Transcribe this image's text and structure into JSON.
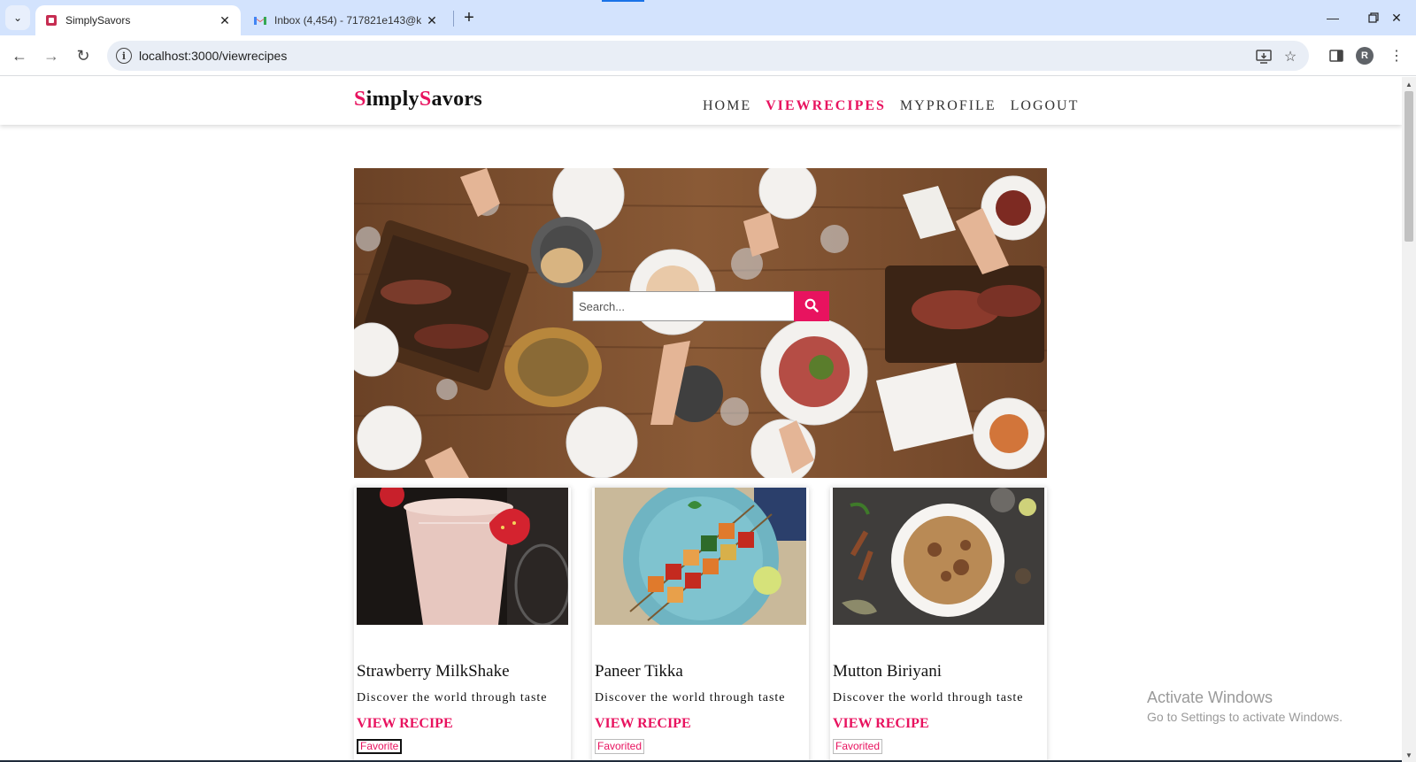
{
  "browser": {
    "tabs": [
      {
        "title": "SimplySavors",
        "active": true,
        "icon": "simplysavors-favicon"
      },
      {
        "title": "Inbox (4,454) - 717821e143@k",
        "active": false,
        "icon": "gmail-icon"
      }
    ],
    "url": "localhost:3000/viewrecipes",
    "profile_initial": "R"
  },
  "site": {
    "logo": {
      "s1": "S",
      "p1": "imply",
      "s2": "S",
      "p2": "avors"
    },
    "nav": {
      "home": "HOME",
      "viewrecipes": "VIEWRECIPES",
      "myprofile": "MYPROFILE",
      "logout": "LOGOUT"
    },
    "active_nav": "viewrecipes",
    "accent_color": "#e8135f",
    "search": {
      "placeholder": "Search..."
    }
  },
  "recipes": [
    {
      "name": "Strawberry MilkShake",
      "description": "Discover the world through taste",
      "link": "VIEW RECIPE",
      "favorite": "Favorite"
    },
    {
      "name": "Paneer Tikka",
      "description": "Discover the world through taste",
      "link": "VIEW RECIPE",
      "favorite": "Favorited"
    },
    {
      "name": "Mutton Biriyani",
      "description": "Discover the world through taste",
      "link": "VIEW RECIPE",
      "favorite": "Favorited"
    }
  ],
  "watermark": {
    "line1": "Activate Windows",
    "line2": "Go to Settings to activate Windows."
  }
}
